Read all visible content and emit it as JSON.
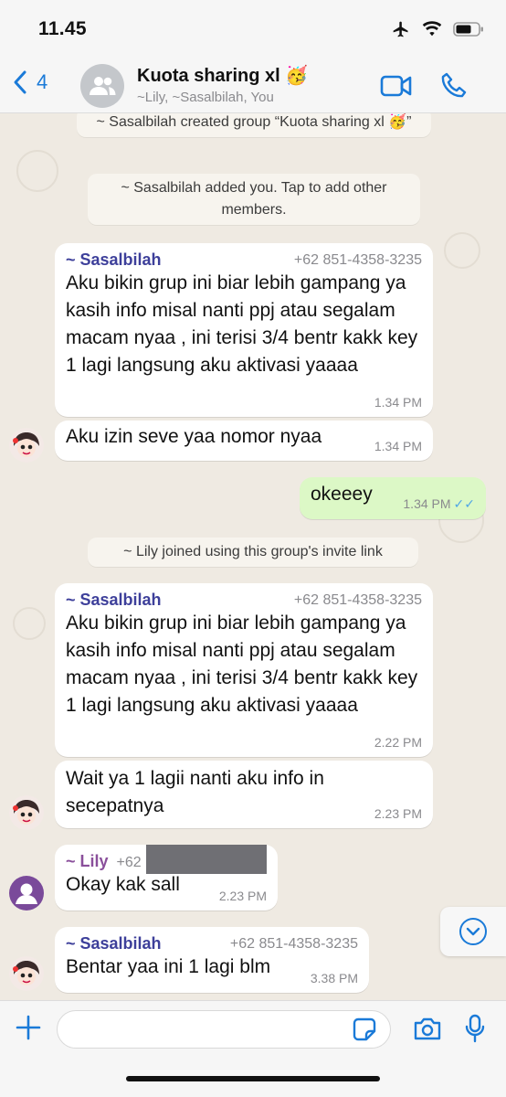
{
  "status": {
    "time": "11.45"
  },
  "header": {
    "back_count": "4",
    "title": "Kuota sharing xl",
    "title_emoji": "🥳",
    "subtitle": "~Lily, ~Sasalbilah, You"
  },
  "system": {
    "created": "~ Sasalbilah created group “Kuota sharing xl 🥳”",
    "added": "~ Sasalbilah added you. Tap to add other members.",
    "joined": "~ Lily joined using this group's invite link"
  },
  "messages": [
    {
      "sender": "~ Sasalbilah",
      "phone": "+62 851-4358-3235",
      "text": "Aku bikin grup ini biar lebih gampang ya kasih info misal nanti ppj atau segalam macam nyaa , ini terisi 3/4 bentr kakk key 1 lagi langsung aku aktivasi yaaaa",
      "time": "1.34 PM"
    },
    {
      "text": "Aku izin seve yaa nomor nyaa",
      "time": "1.34 PM"
    },
    {
      "text": "okeeey",
      "time": "1.34 PM"
    },
    {
      "sender": "~ Sasalbilah",
      "phone": "+62 851-4358-3235",
      "text": "Aku bikin grup ini biar lebih gampang ya kasih info misal nanti ppj atau segalam macam nyaa , ini terisi 3/4 bentr kakk key 1 lagi langsung aku aktivasi yaaaa",
      "time": "2.22 PM"
    },
    {
      "text": "Wait ya 1 lagii nanti aku info in secepatnya",
      "time": "2.23 PM"
    },
    {
      "sender": "~ Lily",
      "phone": "+62",
      "text": "Okay kak sall",
      "time": "2.23 PM"
    },
    {
      "sender": "~ Sasalbilah",
      "phone": "+62 851-4358-3235",
      "text": "Bentar yaa ini 1 lagi blm",
      "time": "3.38 PM"
    }
  ],
  "input": {
    "placeholder": ""
  },
  "colors": {
    "accent": "#1a7ad8",
    "outgoing": "#dcf8c6",
    "wallpaper": "#efeae2",
    "read_ticks": "#4fa6e6"
  },
  "icons": [
    "airplane-icon",
    "wifi-icon",
    "battery-icon",
    "back-chevron-icon",
    "group-icon",
    "video-call-icon",
    "phone-call-icon",
    "chevron-down-icon",
    "plus-icon",
    "sticker-icon",
    "camera-icon",
    "mic-icon"
  ]
}
